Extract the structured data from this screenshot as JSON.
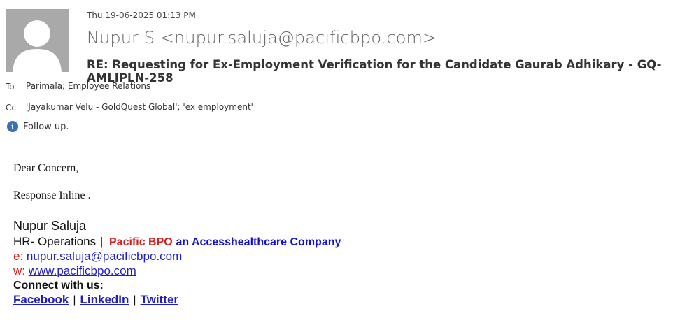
{
  "header": {
    "date": "Thu 19-06-2025 01:13 PM",
    "from": "Nupur S <nupur.saluja@pacificbpo.com>",
    "subject": "RE: Requesting for Ex-Employment Verification for the Candidate Gaurab Adhikary - GQ-AMLIPLN-258",
    "to_label": "To",
    "to_value": "Parimala; Employee Relations",
    "cc_label": "Cc",
    "cc_value": "'Jayakumar Velu - GoldQuest Global'; 'ex employment'",
    "follow_up": "Follow up.",
    "info_glyph": "i"
  },
  "body": {
    "greeting": "Dear Concern,",
    "line1": "Response Inline ."
  },
  "signature": {
    "name": "Nupur Saluja",
    "role": "HR- Operations",
    "pipe": "|",
    "company_red": "Pacific BPO",
    "company_blue": "an Accesshealthcare Company",
    "email_label": "e:",
    "email": "nupur.saluja@pacificbpo.com",
    "web_label": "w:",
    "web": "www.pacificbpo.com",
    "connect": "Connect with us:",
    "social": [
      "Facebook",
      "LinkedIn",
      "Twitter"
    ],
    "social_sep": "|"
  },
  "colors": {
    "avatar_bg": "#a9a9a9",
    "red": "#d42020",
    "blue": "#1010d0",
    "link": "#1f5fa8"
  }
}
